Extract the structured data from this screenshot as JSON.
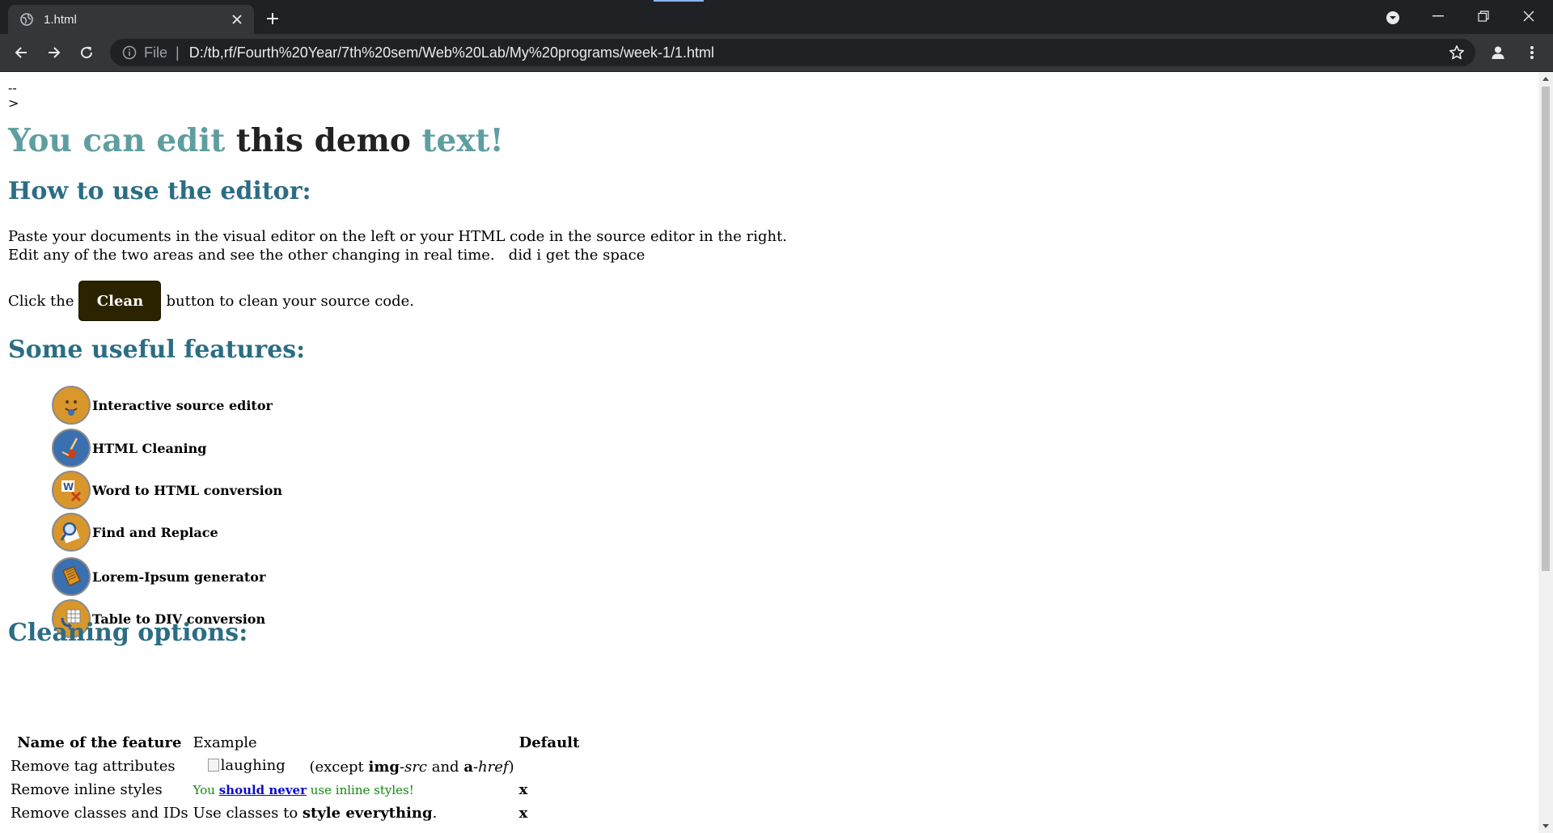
{
  "browser": {
    "tab_title": "1.html",
    "address_scheme": "File",
    "address_separator": "|",
    "address_url": "D:/tb,rf/Fourth%20Year/7th%20sem/Web%20Lab/My%20programs/week-1/1.html",
    "accent_color": "#8ab4f8"
  },
  "page": {
    "comment_text": "-->",
    "heading": {
      "part1": "You can edit",
      "part2": "this demo",
      "part3": "text!"
    },
    "how_to_title": "How to use the editor:",
    "how_to_line1": "Paste your documents in the visual editor on the left or your HTML code in the source editor in the right.",
    "how_to_line2": "Edit any of the two areas and see the other changing in real time.   did i get the space",
    "click_prefix": "Click the",
    "clean_button": "Clean",
    "click_suffix": "button to clean your source code.",
    "features_title": "Some useful features:",
    "features": [
      {
        "label": "Interactive source editor",
        "icon": "smiley-icon",
        "color": "#d9962b"
      },
      {
        "label": "HTML Cleaning",
        "icon": "broom-icon",
        "color": "#3a6fb0"
      },
      {
        "label": "Word to HTML conversion",
        "icon": "word-icon",
        "color": "#d9962b"
      },
      {
        "label": "Find and Replace",
        "icon": "magnifier-icon",
        "color": "#d9962b"
      },
      {
        "label": "Lorem-Ipsum generator",
        "icon": "book-icon",
        "color": "#3a6fb0"
      },
      {
        "label": "Table to DIV conversion",
        "icon": "table-icon",
        "color": "#d9962b"
      }
    ],
    "cleaning_title": "Cleaning options:",
    "table": {
      "headers": [
        "Name of the feature",
        "Example",
        "Default"
      ],
      "rows": [
        {
          "name": "Remove tag attributes",
          "img_alt": "laughing",
          "except_prefix": "(except ",
          "img_tag": "img",
          "img_attr": "-src",
          "and_text": " and ",
          "a_tag": "a",
          "a_attr": "-href",
          "except_suffix": ")",
          "default": ""
        },
        {
          "name": "Remove inline styles",
          "ex_prefix": "You ",
          "ex_link": "should never",
          "ex_suffix": " use inline styles!",
          "default": "x"
        },
        {
          "name": "Remove classes and IDs",
          "ex_prefix": "Use classes to ",
          "ex_bold": "style everything",
          "ex_suffix": ".",
          "default": "x"
        }
      ]
    }
  }
}
